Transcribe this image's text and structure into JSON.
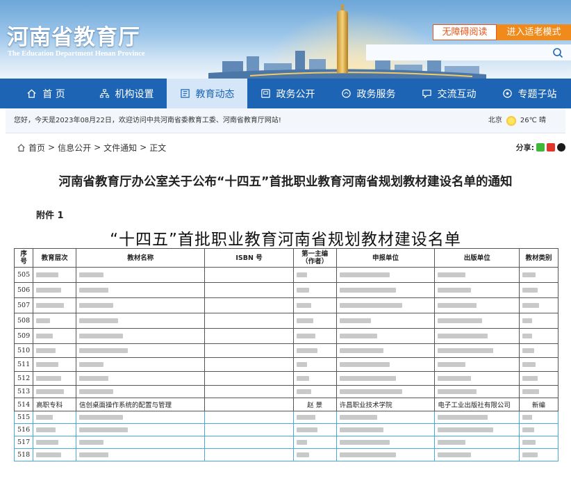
{
  "header": {
    "logo_cn": "河南省教育厅",
    "logo_en": "The Education Department Henan Province",
    "accessibility_label": "无障碍阅读",
    "elder_mode_label": "进入适老模式",
    "search_placeholder": ""
  },
  "nav": [
    {
      "label": "首 页",
      "icon": "home-icon",
      "active": false
    },
    {
      "label": "机构设置",
      "icon": "org-icon",
      "active": false
    },
    {
      "label": "教育动态",
      "icon": "news-icon",
      "active": true
    },
    {
      "label": "政务公开",
      "icon": "doc-icon",
      "active": false
    },
    {
      "label": "政务服务",
      "icon": "service-icon",
      "active": false
    },
    {
      "label": "交流互动",
      "icon": "chat-icon",
      "active": false
    },
    {
      "label": "专题子站",
      "icon": "topic-icon",
      "active": false
    }
  ],
  "welcome": {
    "text": "您好，今天是2023年08月22日，欢迎访问中共河南省委教育工委、河南省教育厅网站!",
    "city": "北京",
    "weather": "26℃ 晴"
  },
  "breadcrumb": {
    "home": "首页",
    "sep1": ">",
    "item1": "信息公开",
    "sep2": ">",
    "item2": "文件通知",
    "sep3": ">",
    "current": "正文",
    "share_label": "分享:"
  },
  "article": {
    "title": "河南省教育厅办公室关于公布“十四五”首批职业教育河南省规划教材建设名单的通知",
    "attachment": "附件 1",
    "list_title": "“十四五”首批职业教育河南省规划教材建设名单"
  },
  "table": {
    "headers": [
      "序号",
      "教育层次",
      "教材名称",
      "ISBN 号",
      "第一主编（作者）",
      "申报单位",
      "出版单位",
      "教材类别"
    ],
    "rows": [
      {
        "no": "505",
        "visible": false
      },
      {
        "no": "506",
        "visible": false
      },
      {
        "no": "507",
        "visible": false
      },
      {
        "no": "508",
        "visible": false
      },
      {
        "no": "509",
        "visible": false
      },
      {
        "no": "510",
        "visible": false
      },
      {
        "no": "511",
        "visible": false
      },
      {
        "no": "512",
        "visible": false
      },
      {
        "no": "513",
        "visible": false
      },
      {
        "no": "514",
        "visible": true,
        "level": "高职专科",
        "name": "信创桌面操作系统的配置与管理",
        "isbn": "",
        "author": "赵 景",
        "applicant": "许昌职业技术学院",
        "publisher": "电子工业出版社有限公司",
        "category": "新编"
      },
      {
        "no": "515",
        "visible": false
      },
      {
        "no": "516",
        "visible": false
      },
      {
        "no": "517",
        "visible": false
      },
      {
        "no": "518",
        "visible": false
      }
    ]
  },
  "colors": {
    "nav_bg": "#1d65b4",
    "nav_active_bg": "#d4e6f7",
    "accent_orange": "#f08a1b",
    "access_border": "#e4571b"
  }
}
